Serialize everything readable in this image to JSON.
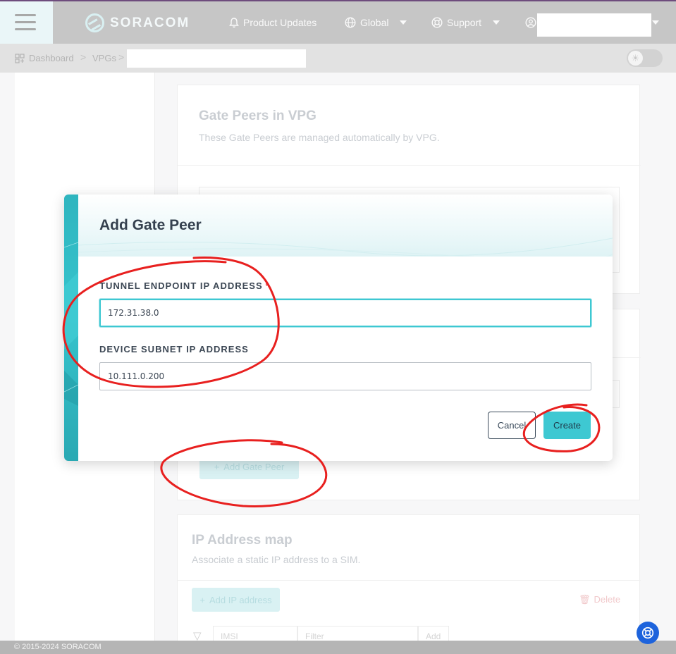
{
  "header": {
    "brand": "SORACOM",
    "product_updates": "Product Updates",
    "global": "Global",
    "support": "Support",
    "icons": [
      "menu-icon",
      "bell-icon",
      "globe-icon",
      "lifebuoy-icon",
      "user-circle-icon"
    ]
  },
  "breadcrumb": {
    "items": [
      "Dashboard",
      "VPGs"
    ],
    "separator": ">"
  },
  "background": {
    "gate_peers_card": {
      "title": "Gate Peers in VPG",
      "subtitle": "These Gate Peers are managed automatically by VPG.",
      "add_button": "Add Gate Peer"
    },
    "ip_map_card": {
      "title": "IP Address map",
      "subtitle": "Associate a static IP address to a SIM.",
      "add_button": "Add IP address",
      "delete_button": "Delete",
      "filter_select": "IMSI",
      "filter_placeholder": "Filter",
      "filter_add": "Add"
    }
  },
  "modal": {
    "title": "Add Gate Peer",
    "tunnel_label": "TUNNEL ENDPOINT IP ADDRESS",
    "required_mark": "*",
    "tunnel_value": "172.31.38.0",
    "subnet_label": "DEVICE SUBNET IP ADDRESS",
    "subnet_value": "10.111.0.200",
    "cancel_label": "Cancel",
    "create_label": "Create"
  },
  "footer": {
    "copyright": "© 2015-2024 SORACOM"
  },
  "colors": {
    "accent": "#3ec8d2",
    "band": "#2fb5bf",
    "annotation": "#e8201f",
    "fab": "#1d63dc"
  }
}
